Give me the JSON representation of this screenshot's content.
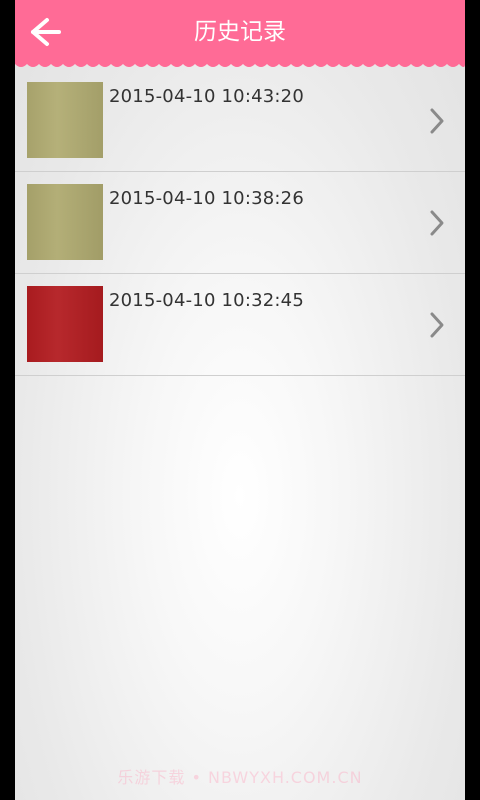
{
  "header": {
    "title": "历史记录",
    "back_icon": "arrow-left-icon",
    "color": "#ff6b96"
  },
  "history": [
    {
      "time": "2015-04-10 10:43:20",
      "thumb_color": "#b1ac72",
      "chevron_icon": "chevron-right-icon"
    },
    {
      "time": "2015-04-10 10:38:26",
      "thumb_color": "#afaa70",
      "chevron_icon": "chevron-right-icon"
    },
    {
      "time": "2015-04-10 10:32:45",
      "thumb_color": "#b31d21",
      "chevron_icon": "chevron-right-icon"
    }
  ],
  "watermark": "乐游下载 • NBWYXH.COM.CN"
}
